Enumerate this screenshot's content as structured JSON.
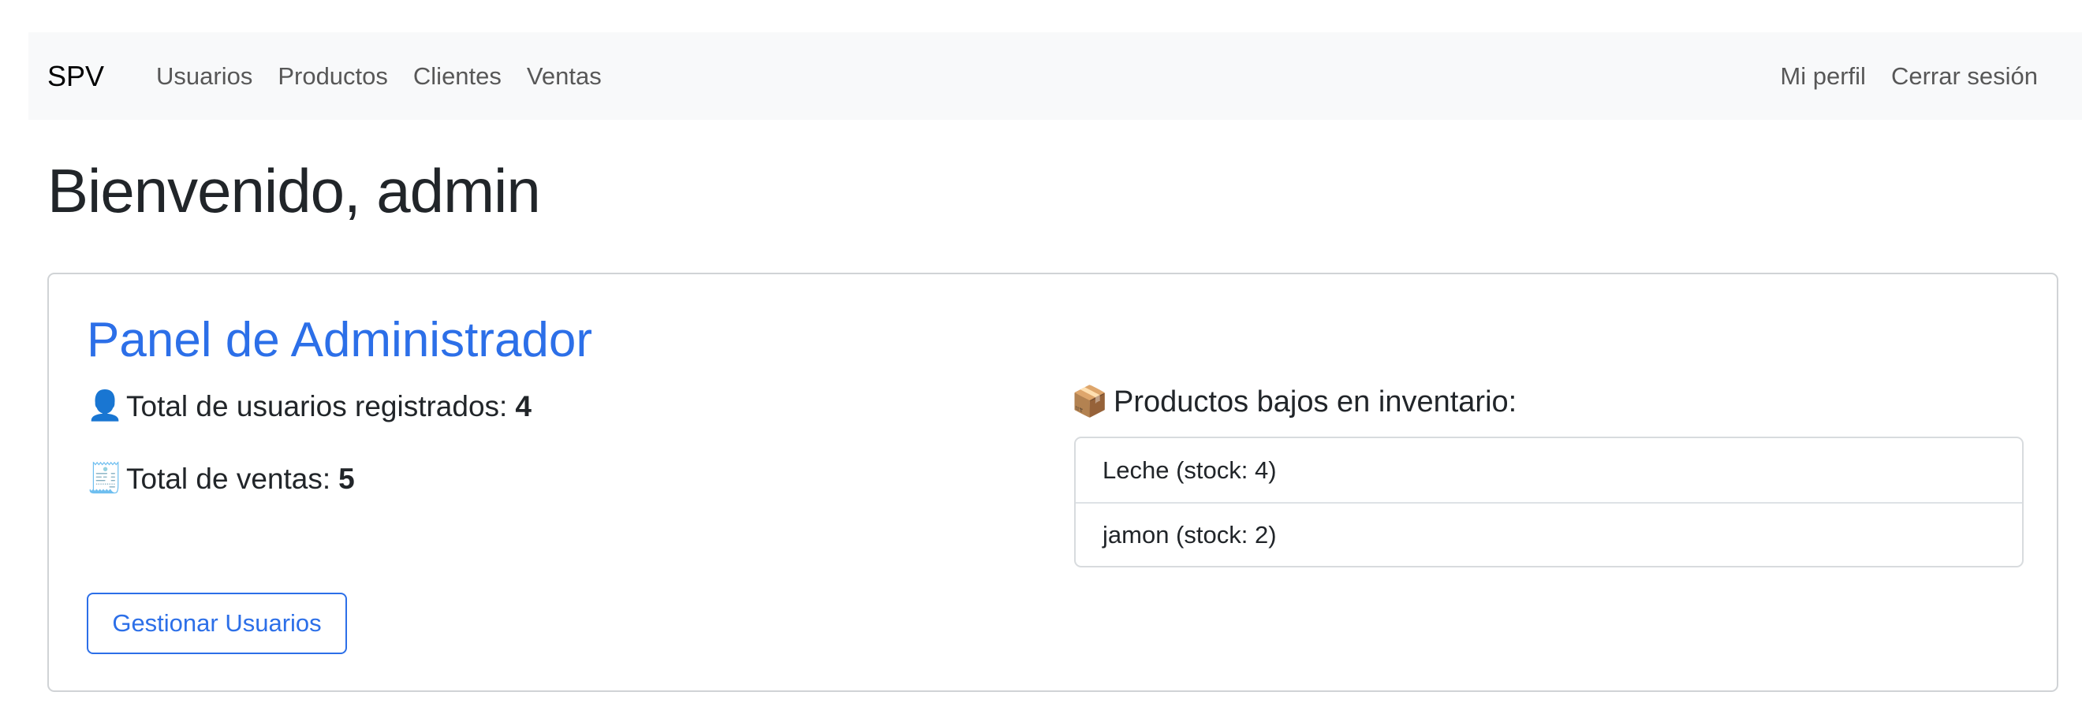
{
  "navbar": {
    "brand": "SPV",
    "left_links": [
      "Usuarios",
      "Productos",
      "Clientes",
      "Ventas"
    ],
    "right_links": [
      "Mi perfil",
      "Cerrar sesión"
    ]
  },
  "page": {
    "welcome": "Bienvenido, admin"
  },
  "admin_panel": {
    "title": "Panel de Administrador",
    "users_icon": "👤",
    "users_label": "Total de usuarios registrados:",
    "users_count": "4",
    "sales_icon": "🧾",
    "sales_label": "Total de ventas:",
    "sales_count": "5",
    "manage_users_button": "Gestionar Usuarios",
    "low_stock_icon": "📦",
    "low_stock_title": "Productos bajos en inventario:",
    "low_stock_items": [
      "Leche (stock: 4)",
      "jamon (stock: 2)"
    ]
  },
  "colors": {
    "accent": "#2c6fe8",
    "navbar_bg": "#f8f9fa"
  }
}
